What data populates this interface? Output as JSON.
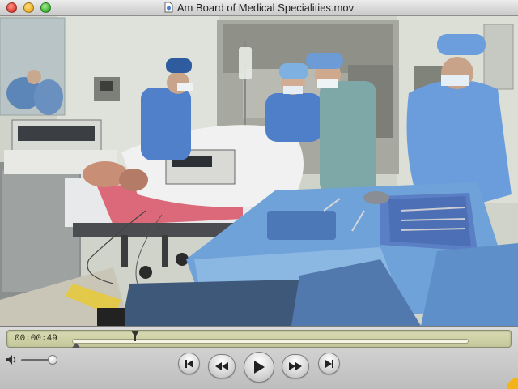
{
  "window": {
    "title": "Am Board of Medical Specialities.mov"
  },
  "player": {
    "timecode": "00:00:49",
    "playhead_fraction": 0.16,
    "volume_fraction": 0.88
  },
  "colors": {
    "scrubber_bg": "#cfd2a6",
    "scrub_text": "#2a2d1a",
    "scrubs_blue": "#4f80c9",
    "drape_blue": "#6fa2d8"
  },
  "icons": {
    "title_doc": "document-icon",
    "volume": "speaker-icon",
    "skip_back": "skip-to-start-icon",
    "rewind": "rewind-icon",
    "play": "play-icon",
    "fast_forward": "fast-forward-icon",
    "skip_forward": "skip-to-end-icon"
  }
}
